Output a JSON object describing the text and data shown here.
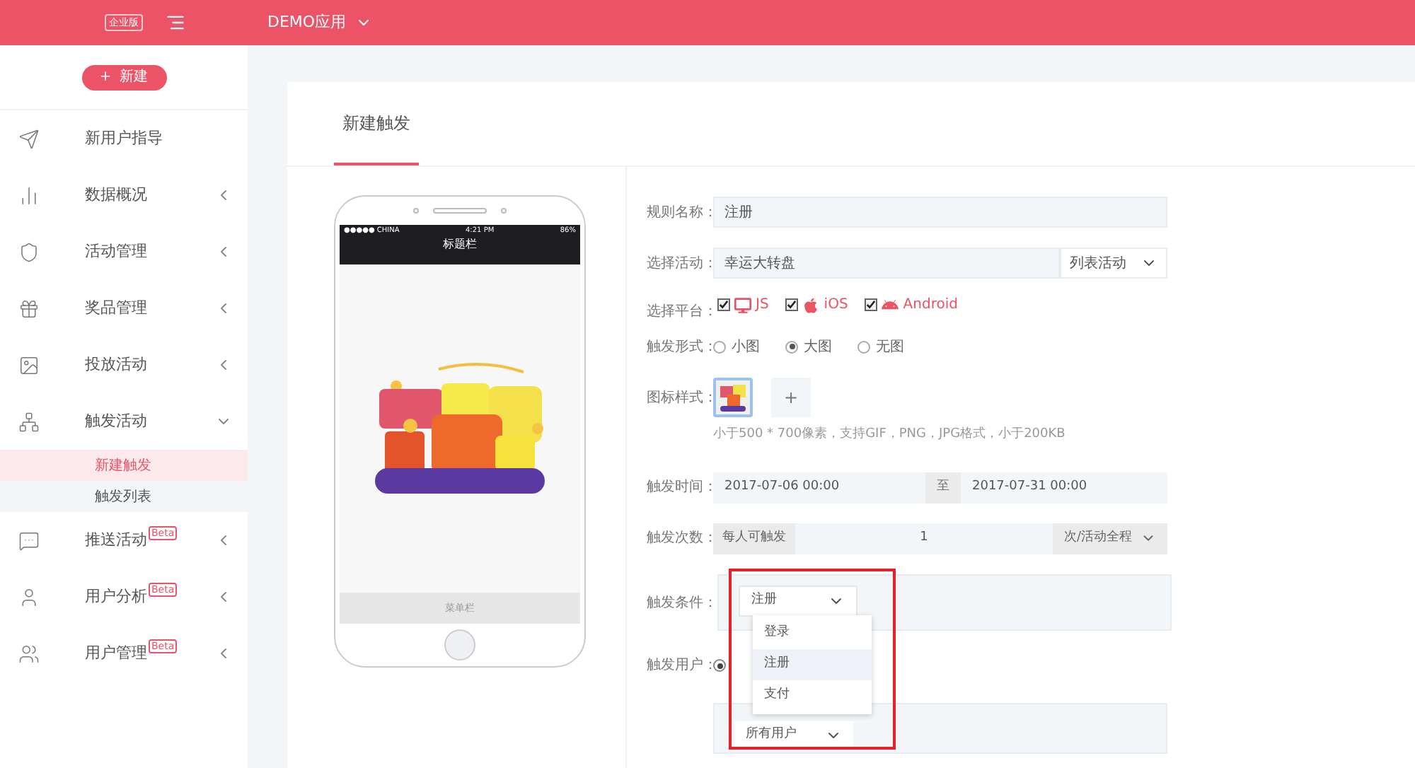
{
  "topbar": {
    "edition_badge": "企业版",
    "app_name": "DEMO应用"
  },
  "sidebar": {
    "new_button": {
      "icon": "+",
      "label": "新建"
    },
    "items": [
      {
        "label": "新用户指导",
        "has_arrow": false
      },
      {
        "label": "数据概况",
        "expanded": false,
        "has_arrow": true
      },
      {
        "label": "活动管理",
        "expanded": false,
        "has_arrow": true
      },
      {
        "label": "奖品管理",
        "expanded": false,
        "has_arrow": true
      },
      {
        "label": "投放活动",
        "expanded": false,
        "has_arrow": true
      },
      {
        "label": "触发活动",
        "expanded": true,
        "has_arrow": true,
        "children": [
          {
            "label": "新建触发",
            "selected": true
          },
          {
            "label": "触发列表",
            "selected": false
          }
        ]
      },
      {
        "label": "推送活动",
        "badge": "Beta",
        "expanded": false,
        "has_arrow": true
      },
      {
        "label": "用户分析",
        "badge": "Beta",
        "expanded": false,
        "has_arrow": true
      },
      {
        "label": "用户管理",
        "badge": "Beta",
        "expanded": false,
        "has_arrow": true
      }
    ]
  },
  "card": {
    "tab": "新建触发"
  },
  "phone": {
    "carrier": "●●●●● CHINA",
    "time": "4:21 PM",
    "battery": "86%",
    "title_bar": "标题栏",
    "menu_bar": "菜单栏"
  },
  "form": {
    "rule_name": {
      "label": "规则名称：",
      "value": "注册"
    },
    "activity": {
      "label": "选择活动：",
      "value": "幸运大转盘",
      "type_select": "列表活动"
    },
    "platforms": {
      "label": "选择平台：",
      "options": [
        {
          "label": "JS",
          "checked": true
        },
        {
          "label": "iOS",
          "checked": true
        },
        {
          "label": "Android",
          "checked": true
        }
      ]
    },
    "trigger_form": {
      "label": "触发形式：",
      "options": [
        {
          "label": "小图",
          "selected": false
        },
        {
          "label": "大图",
          "selected": true
        },
        {
          "label": "无图",
          "selected": false
        }
      ]
    },
    "icon_style": {
      "label": "图标样式：",
      "add": "+",
      "hint": "小于500 * 700像素，支持GIF，PNG，JPG格式，小于200KB"
    },
    "trigger_time": {
      "label": "触发时间：",
      "start": "2017-07-06 00:00",
      "separator": "至",
      "end": "2017-07-31 00:00"
    },
    "trigger_count": {
      "label": "触发次数：",
      "prefix": "每人可触发",
      "value": "1",
      "unit": "次/活动全程"
    },
    "trigger_condition": {
      "label": "触发条件：",
      "value": "注册",
      "options": [
        {
          "label": "登录",
          "selected": false
        },
        {
          "label": "注册",
          "selected": true
        },
        {
          "label": "支付",
          "selected": false
        }
      ]
    },
    "trigger_users": {
      "label": "触发用户：",
      "radio_selected": true,
      "value": "所有用户"
    }
  }
}
